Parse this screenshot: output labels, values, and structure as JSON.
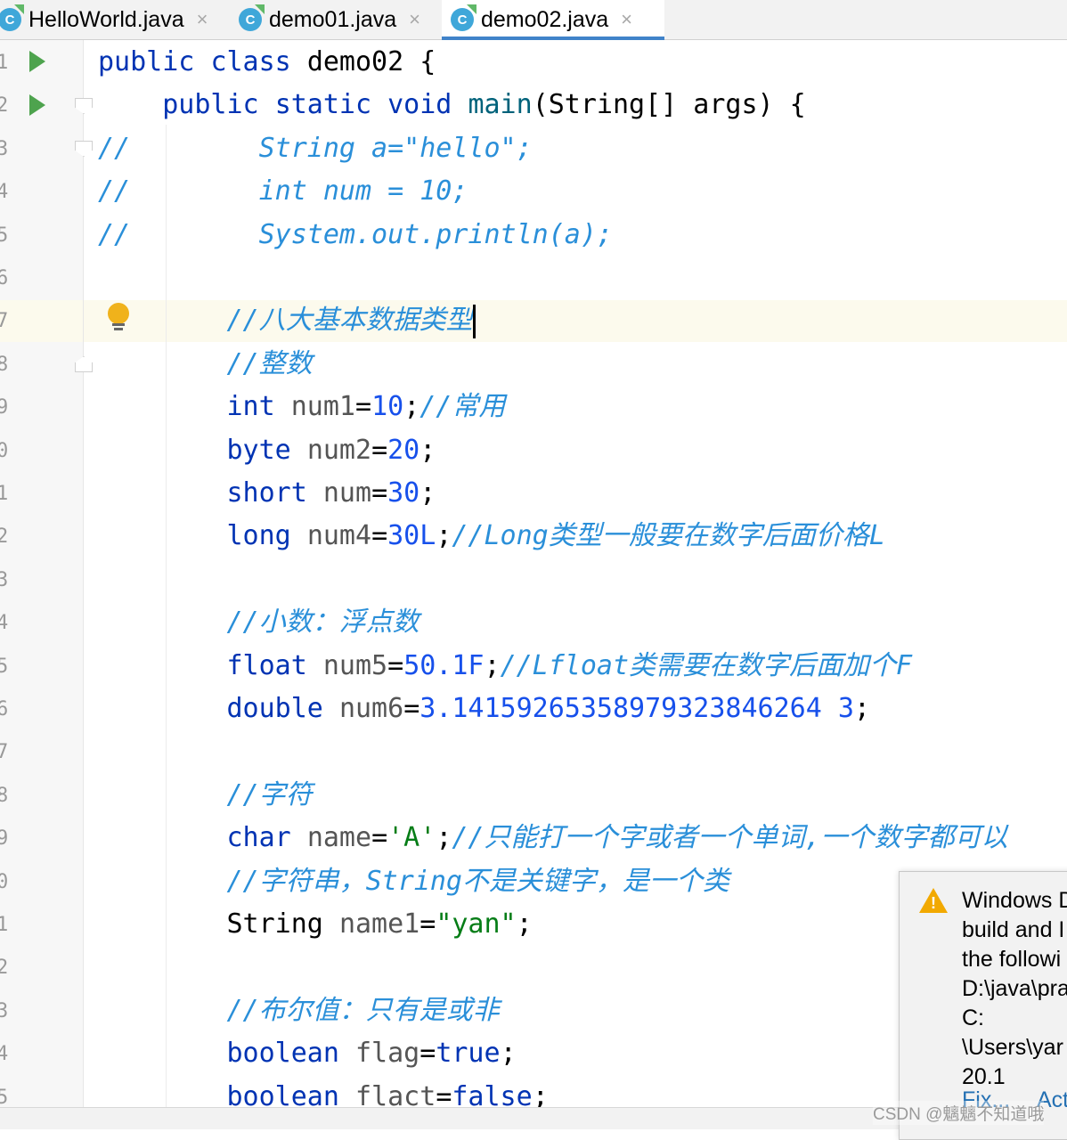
{
  "tabs": [
    {
      "label": "HelloWorld.java",
      "icon": "java-class-icon",
      "close": "×",
      "active": false
    },
    {
      "label": "demo01.java",
      "icon": "java-class-icon",
      "close": "×",
      "active": false
    },
    {
      "label": "demo02.java",
      "icon": "java-class-icon",
      "close": "×",
      "active": true
    }
  ],
  "file_icon_letter": "C",
  "line_numbers": [
    "1",
    "2",
    "3",
    "4",
    "5",
    "6",
    "7",
    "8",
    "9",
    "0",
    "1",
    "2",
    "3",
    "4",
    "5",
    "6",
    "7",
    "8",
    "9",
    "0",
    "1",
    "2",
    "3",
    "4",
    "5"
  ],
  "code": [
    [
      [
        "kw",
        "public "
      ],
      [
        "kw",
        "class "
      ],
      [
        "id",
        "demo02 "
      ],
      [
        "id",
        "{"
      ]
    ],
    [
      [
        "id",
        "    "
      ],
      [
        "kw",
        "public "
      ],
      [
        "kw",
        "static "
      ],
      [
        "kw",
        "void "
      ],
      [
        "fn",
        "main"
      ],
      [
        "id",
        "(String[] args) {"
      ]
    ],
    [
      [
        "cm",
        "//        String a=\"hello\";"
      ]
    ],
    [
      [
        "cm",
        "//        int num = 10;"
      ]
    ],
    [
      [
        "cm",
        "//        System.out.println(a);"
      ]
    ],
    [],
    [
      [
        "id",
        "        "
      ],
      [
        "cm",
        "//八大基本数据类型"
      ]
    ],
    [
      [
        "id",
        "        "
      ],
      [
        "cm",
        "//整数"
      ]
    ],
    [
      [
        "id",
        "        "
      ],
      [
        "kw",
        "int "
      ],
      [
        "var",
        "num1"
      ],
      [
        "id",
        "="
      ],
      [
        "num",
        "10"
      ],
      [
        "id",
        ";"
      ],
      [
        "cm",
        "//常用"
      ]
    ],
    [
      [
        "id",
        "        "
      ],
      [
        "kw",
        "byte "
      ],
      [
        "var",
        "num2"
      ],
      [
        "id",
        "="
      ],
      [
        "num",
        "20"
      ],
      [
        "id",
        ";"
      ]
    ],
    [
      [
        "id",
        "        "
      ],
      [
        "kw",
        "short "
      ],
      [
        "var",
        "num"
      ],
      [
        "id",
        "="
      ],
      [
        "num",
        "30"
      ],
      [
        "id",
        ";"
      ]
    ],
    [
      [
        "id",
        "        "
      ],
      [
        "kw",
        "long "
      ],
      [
        "var",
        "num4"
      ],
      [
        "id",
        "="
      ],
      [
        "num",
        "30L"
      ],
      [
        "id",
        ";"
      ],
      [
        "cm",
        "//Long类型一般要在数字后面价格L"
      ]
    ],
    [],
    [
      [
        "id",
        "        "
      ],
      [
        "cm",
        "//小数：浮点数"
      ]
    ],
    [
      [
        "id",
        "        "
      ],
      [
        "kw",
        "float "
      ],
      [
        "var",
        "num5"
      ],
      [
        "id",
        "="
      ],
      [
        "num",
        "50.1F"
      ],
      [
        "id",
        ";"
      ],
      [
        "cm",
        "//Lfloat类需要在数字后面加个F"
      ]
    ],
    [
      [
        "id",
        "        "
      ],
      [
        "kw",
        "double "
      ],
      [
        "var",
        "num6"
      ],
      [
        "id",
        "="
      ],
      [
        "num",
        "3.14159265358979323846264 3"
      ],
      [
        "id",
        ";"
      ]
    ],
    [],
    [
      [
        "id",
        "        "
      ],
      [
        "cm",
        "//字符"
      ]
    ],
    [
      [
        "id",
        "        "
      ],
      [
        "kw",
        "char "
      ],
      [
        "var",
        "name"
      ],
      [
        "id",
        "="
      ],
      [
        "str",
        "'A'"
      ],
      [
        "id",
        ";"
      ],
      [
        "cm",
        "//只能打一个字或者一个单词,一个数字都可以"
      ]
    ],
    [
      [
        "id",
        "        "
      ],
      [
        "cm",
        "//字符串，String不是关键字，是一个类"
      ]
    ],
    [
      [
        "id",
        "        "
      ],
      [
        "id",
        "String "
      ],
      [
        "var",
        "name1"
      ],
      [
        "id",
        "="
      ],
      [
        "str",
        "\"yan\""
      ],
      [
        "id",
        ";"
      ]
    ],
    [],
    [
      [
        "id",
        "        "
      ],
      [
        "cm",
        "//布尔值：只有是或非"
      ]
    ],
    [
      [
        "id",
        "        "
      ],
      [
        "kw",
        "boolean "
      ],
      [
        "var",
        "flag"
      ],
      [
        "id",
        "="
      ],
      [
        "kw",
        "true"
      ],
      [
        "id",
        ";"
      ]
    ],
    [
      [
        "id",
        "        "
      ],
      [
        "kw",
        "boolean "
      ],
      [
        "var",
        "flact"
      ],
      [
        "id",
        "="
      ],
      [
        "kw",
        "false"
      ],
      [
        "id",
        ";"
      ]
    ]
  ],
  "notification": {
    "icon": "warning-icon",
    "lines": [
      "Windows D",
      "build and I",
      "the followi",
      "D:\\java\\pra",
      "C:",
      "\\Users\\yar",
      "20.1"
    ],
    "actions": [
      "Fix...",
      "Act"
    ]
  },
  "watermark": "CSDN @魑魑不知道哦"
}
